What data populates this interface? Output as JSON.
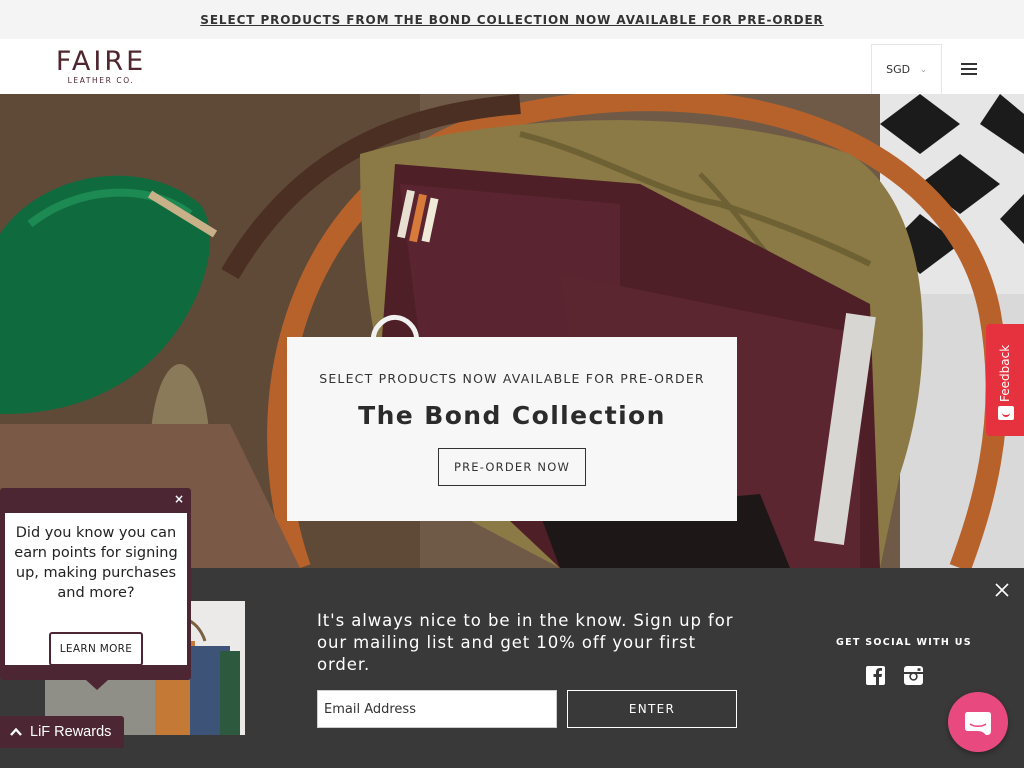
{
  "announcement": {
    "text": "SELECT PRODUCTS FROM THE BOND COLLECTION NOW AVAILABLE FOR PRE-ORDER"
  },
  "header": {
    "logo_main": "FAIRE",
    "logo_sub": "LEATHER CO.",
    "currency": "SGD",
    "menu_icon": "hamburger-icon"
  },
  "hero": {
    "eyebrow": "SELECT PRODUCTS NOW AVAILABLE FOR PRE-ORDER",
    "title": "The Bond Collection",
    "button_label": "PRE-ORDER NOW"
  },
  "feedback": {
    "label": "Feedback"
  },
  "newsletter": {
    "text": "It's always nice to be in the know. Sign up for our mailing list and get 10% off your first order.",
    "email_placeholder": "Email Address",
    "enter_label": "ENTER",
    "social_heading": "GET SOCIAL WITH US"
  },
  "popup": {
    "close_label": "×",
    "message": "Did you know you can earn points for signing up, making purchases and more?",
    "learn_more_label": "LEARN MORE"
  },
  "rewards": {
    "label": "LiF Rewards"
  },
  "colors": {
    "brand": "#4c2733",
    "newsletter_bg": "#3a3939",
    "feedback_red": "#e6313e",
    "chat_pink": "#e84a80"
  }
}
